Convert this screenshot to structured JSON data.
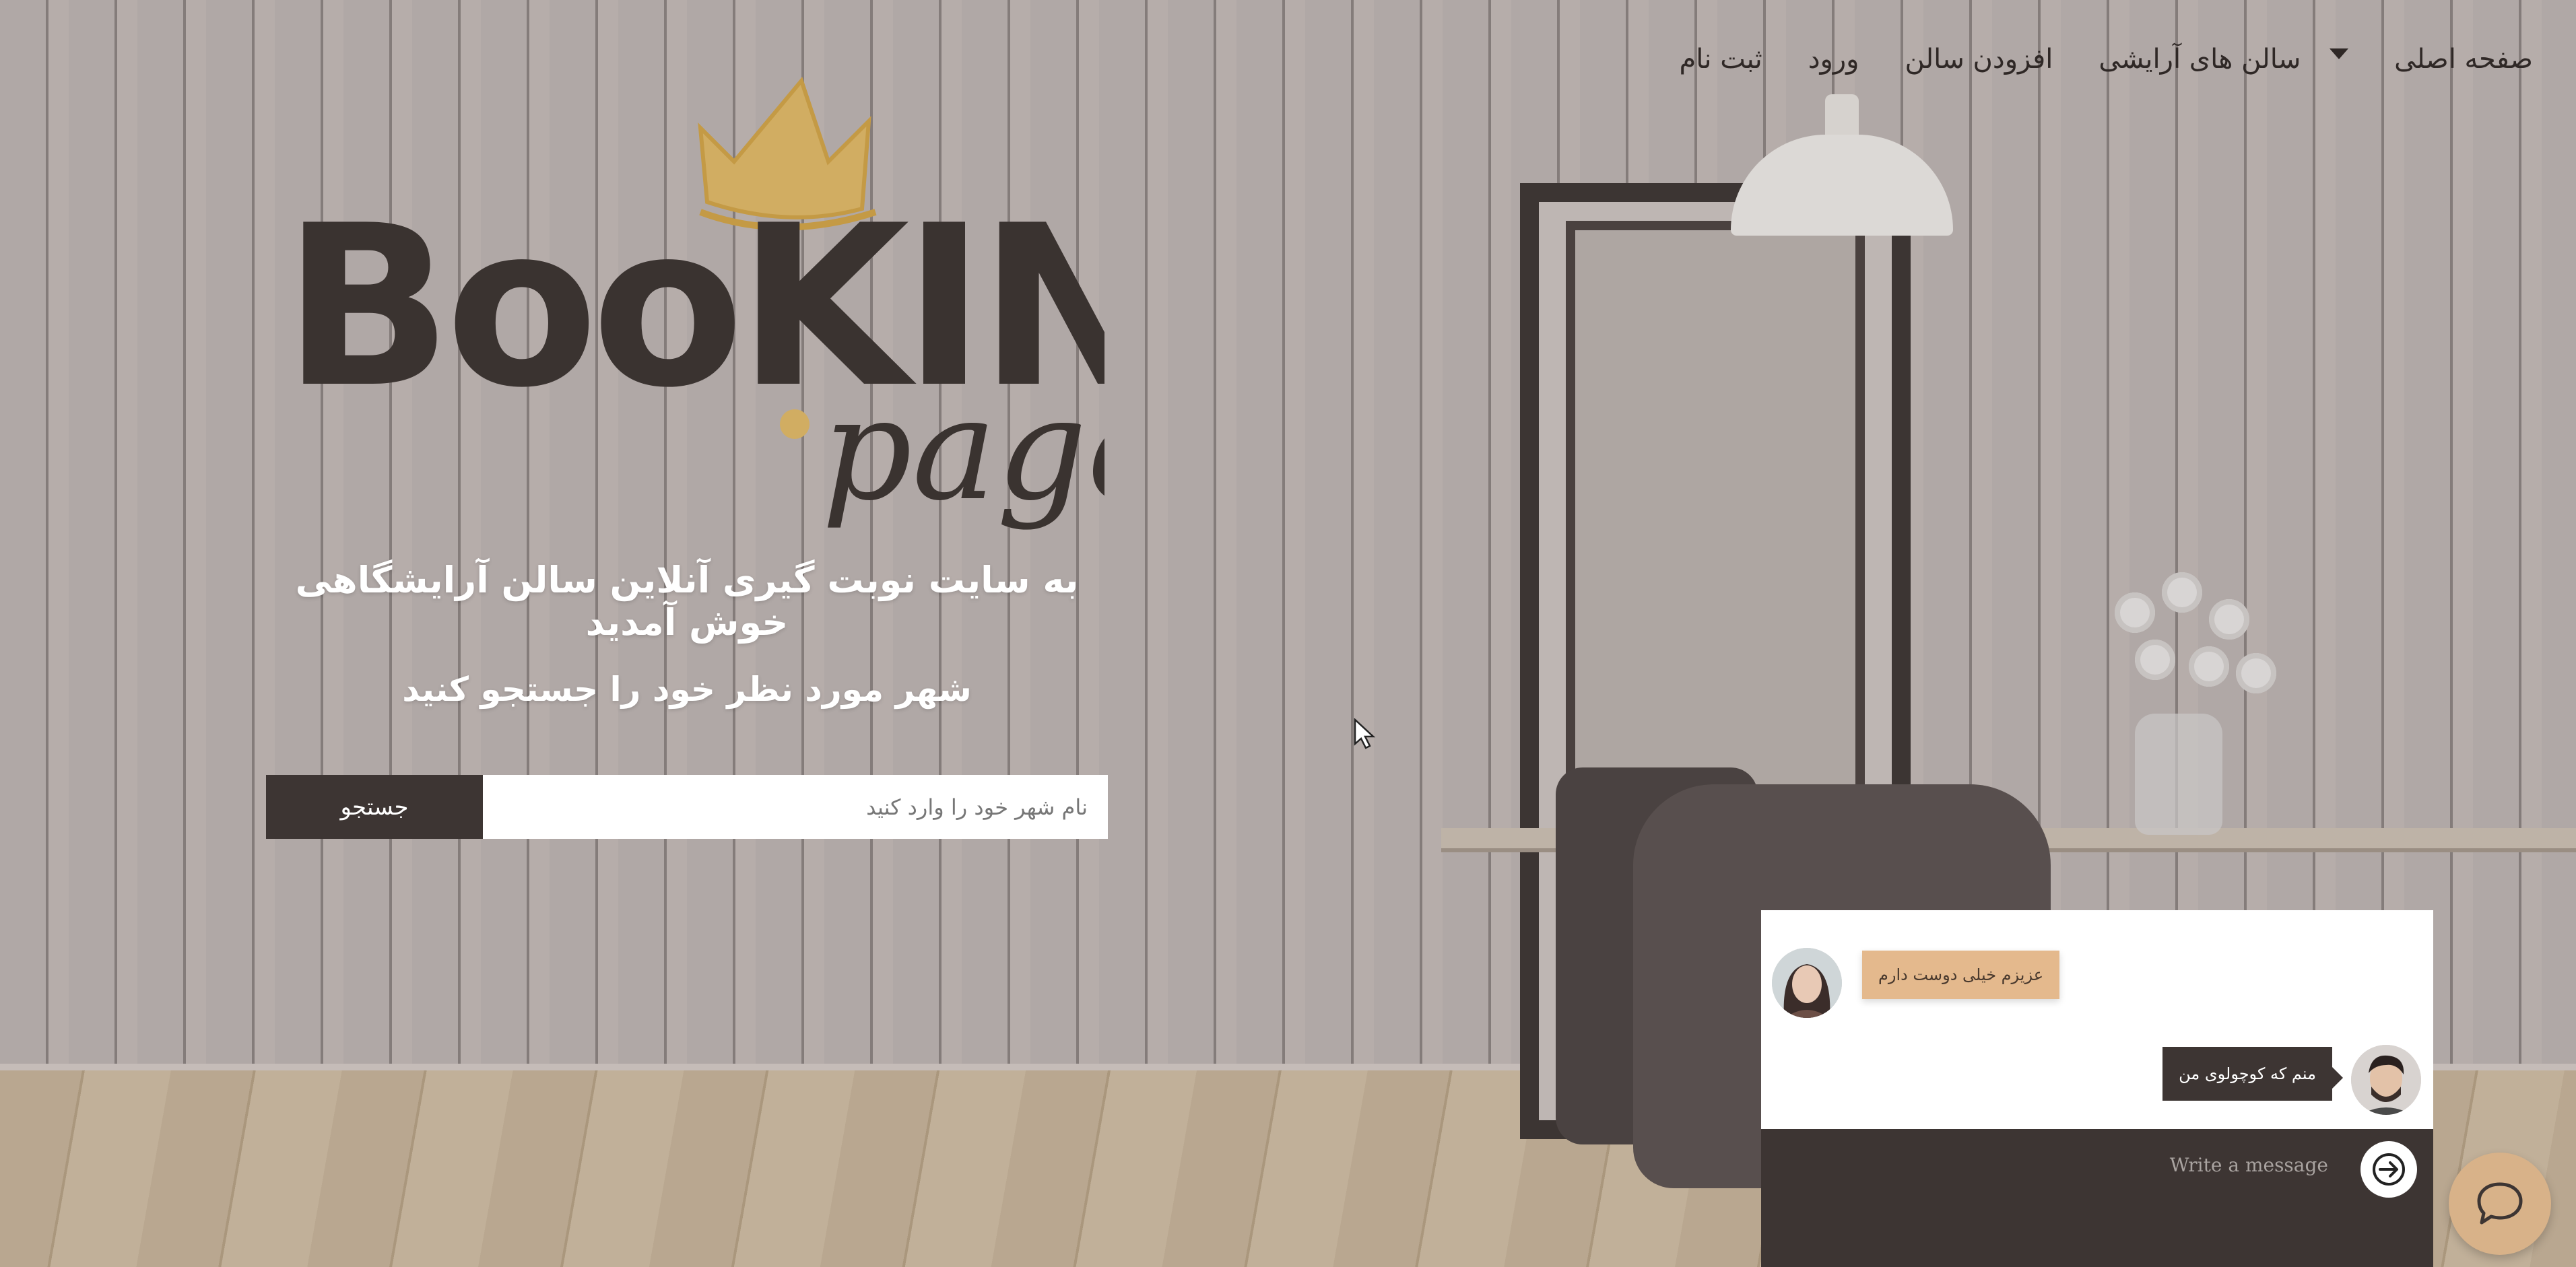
{
  "nav": {
    "home": "صفحه اصلی",
    "salons": "سالن های آرایشی",
    "add_salon": "افزودن سالن",
    "login": "ورود",
    "signup": "ثبت نام"
  },
  "logo": {
    "word": "BooKING",
    "sub": "page",
    "icon": "crown-icon",
    "accent_color": "#d1ad62"
  },
  "hero": {
    "headline": "به سایت نوبت گیری آنلاین سالن آرایشگاهی خوش آمدید",
    "subhead": "شهر مورد نظر خود را جستجو کنید"
  },
  "search": {
    "placeholder": "نام شهر خود را وارد کنید",
    "button_label": "جستجو"
  },
  "chat": {
    "messages": [
      {
        "text": "عزیزم خیلی دوست دارم",
        "side": "left"
      },
      {
        "text": "منم که کوچولوی من",
        "side": "right"
      }
    ],
    "input_placeholder": "Write a message",
    "send_icon": "arrow-right-icon",
    "fab_icon": "chat-bubble-icon"
  },
  "colors": {
    "dark": "#3d3533",
    "bubble_in": "#e4b98d",
    "fab": "#d8b289",
    "white": "#ffffff"
  }
}
